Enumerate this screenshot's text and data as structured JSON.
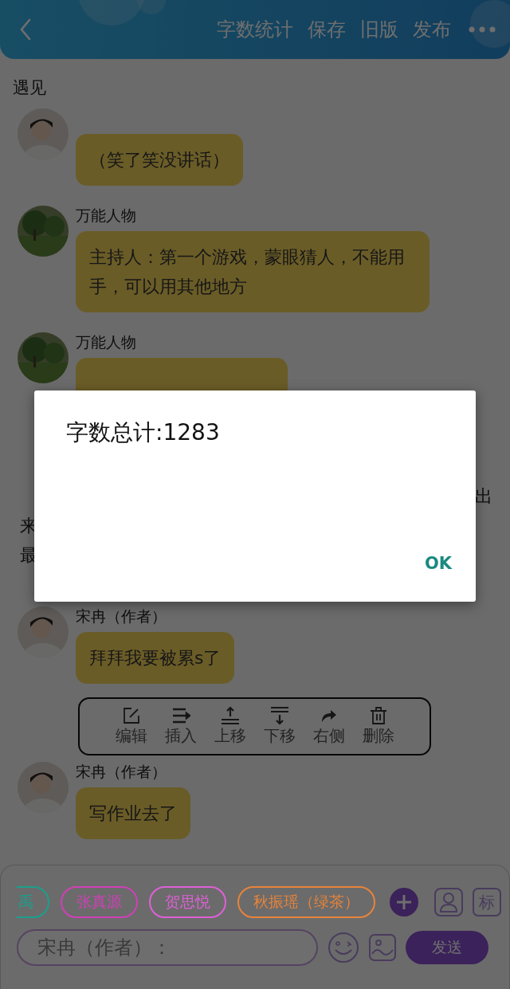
{
  "header": {
    "actions": [
      {
        "label": "字数统计"
      },
      {
        "label": "保存"
      },
      {
        "label": "旧版"
      },
      {
        "label": "发布"
      }
    ]
  },
  "title": "遇见",
  "feed": [
    {
      "kind": "message",
      "text": "（笑了笑没讲话）"
    },
    {
      "kind": "message",
      "name": "万能人物",
      "text": "主持人：第一个游戏，蒙眼猜人，不能用手，可以用其他地方"
    },
    {
      "kind": "message",
      "name": "万能人物"
    },
    {
      "kind": "narration",
      "lines": [
        {
          "right": "出"
        },
        {
          "left": "来"
        },
        {
          "left": "最"
        }
      ]
    },
    {
      "kind": "message",
      "name": "宋冉（作者）",
      "text": "拜拜我要被累s了"
    },
    {
      "kind": "actions",
      "items": [
        {
          "kind": "edit",
          "label": "编辑"
        },
        {
          "kind": "insert",
          "label": "插入"
        },
        {
          "kind": "up",
          "label": "上移"
        },
        {
          "kind": "down",
          "label": "下移"
        },
        {
          "kind": "right",
          "label": "右侧"
        },
        {
          "kind": "delete",
          "label": "删除"
        }
      ]
    },
    {
      "kind": "message",
      "name": "宋冉（作者）",
      "text": "写作业去了"
    }
  ],
  "composer": {
    "chips": [
      {
        "label": "禹",
        "color": "#1aa08c"
      },
      {
        "label": "张真源",
        "color": "#d040b8"
      },
      {
        "label": "贺思悦",
        "color": "#e060d8"
      },
      {
        "label": "秋振瑶（绿茶）",
        "color": "#e8843a"
      }
    ],
    "mark_button": "标",
    "placeholder": "宋冉（作者）：",
    "send": "发送"
  },
  "dialog": {
    "title": "字数总计:1283",
    "button": "OK"
  }
}
